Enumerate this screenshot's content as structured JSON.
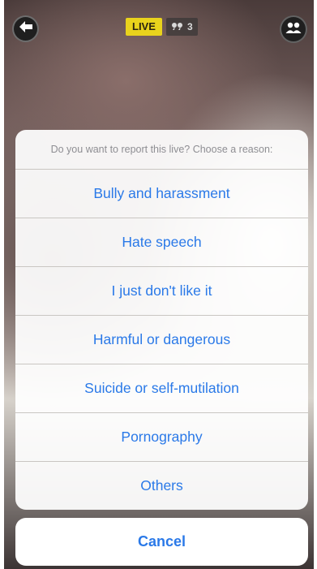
{
  "header": {
    "live_label": "LIVE",
    "viewer_count": "3",
    "back_icon": "arrow-left-icon",
    "viewers_icon": "viewers-icon",
    "people_icon": "people-icon"
  },
  "report_sheet": {
    "title": "Do you want to report this live? Choose a reason:",
    "options": [
      "Bully and harassment",
      "Hate speech",
      "I just don't like it",
      "Harmful or dangerous",
      "Suicide or self-mutilation",
      "Pornography",
      "Others"
    ],
    "cancel_label": "Cancel"
  },
  "colors": {
    "accent": "#2a79e8",
    "live_badge": "#e9d31c"
  }
}
